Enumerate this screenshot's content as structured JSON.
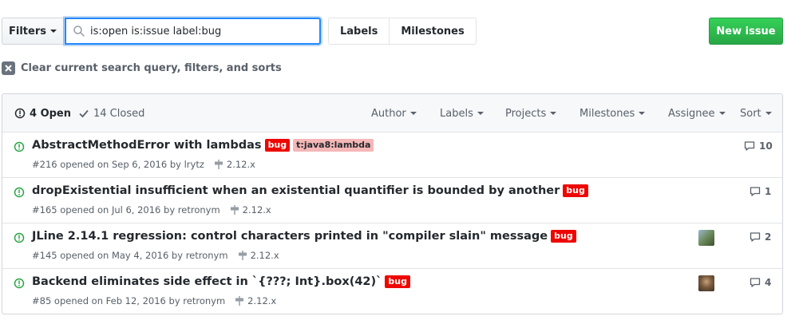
{
  "toolbar": {
    "filters_label": "Filters",
    "search_value": "is:open is:issue label:bug",
    "labels_label": "Labels",
    "milestones_label": "Milestones",
    "new_issue_label": "New issue"
  },
  "clear_filters_label": "Clear current search query, filters, and sorts",
  "header": {
    "open_label": "4 Open",
    "closed_label": "14 Closed",
    "menus": [
      "Author",
      "Labels",
      "Projects",
      "Milestones",
      "Assignee",
      "Sort"
    ]
  },
  "issues": [
    {
      "title": "AbstractMethodError with lambdas",
      "labels": [
        "bug",
        "t:java8:lambda"
      ],
      "meta": "#216 opened on Sep 6, 2016 by lrytz",
      "milestone": "2.12.x",
      "comments": "10"
    },
    {
      "title": "dropExistential insufficient when an existential quantifier is bounded by another",
      "labels": [
        "bug"
      ],
      "meta": "#165 opened on Jul 6, 2016 by retronym",
      "milestone": "2.12.x",
      "comments": "1"
    },
    {
      "title": "JLine 2.14.1 regression: control characters printed in \"compiler slain\" message",
      "labels": [
        "bug"
      ],
      "meta": "#145 opened on May 4, 2016 by retronym",
      "milestone": "2.12.x",
      "comments": "2"
    },
    {
      "title": "Backend eliminates side effect in `{???; Int}.box(42)`",
      "labels": [
        "bug"
      ],
      "meta": "#85 opened on Feb 12, 2016 by retronym",
      "milestone": "2.12.x",
      "comments": "4"
    }
  ],
  "colors": {
    "accent_blue": "#2188ff",
    "open_green": "#28a745",
    "bug_red": "#ee0701",
    "lambda_pink": "#f5b7b7"
  }
}
